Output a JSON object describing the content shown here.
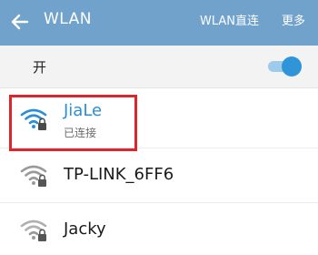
{
  "header": {
    "title": "WLAN",
    "direct_label": "WLAN直连",
    "more_label": "更多",
    "back_icon": "back-arrow-icon",
    "background_color": "#70a2cb"
  },
  "wlan_toggle": {
    "label": "开",
    "enabled": true,
    "accent_color": "#2f95d8"
  },
  "networks": [
    {
      "ssid": "JiaLe",
      "status": "已连接",
      "icon": "wifi-lock-icon",
      "connected": true
    },
    {
      "ssid": "TP-LINK_6FF6",
      "icon": "wifi-lock-icon",
      "connected": false
    },
    {
      "ssid": "Jacky",
      "icon": "wifi-lock-icon",
      "connected": false
    }
  ],
  "highlight_color": "#e0242b"
}
